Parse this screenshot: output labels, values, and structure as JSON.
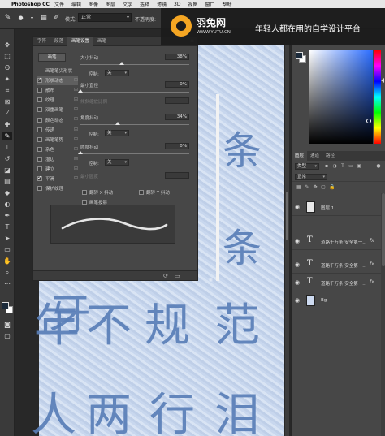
{
  "menubar": {
    "app_name": "Photoshop CC",
    "items": [
      "文件",
      "编辑",
      "图像",
      "图层",
      "文字",
      "选择",
      "滤镜",
      "3D",
      "视图",
      "窗口",
      "帮助"
    ]
  },
  "options_bar": {
    "mode_label": "模式:",
    "mode_value": "正常",
    "opacity_label": "不透明度:"
  },
  "banner": {
    "brand": "羽兔网",
    "url": "WWW.YUTU.CN",
    "slogan": "年轻人都在用的自学设计平台"
  },
  "brush_panel": {
    "tabs": [
      "字符",
      "段落",
      "画笔设置",
      "画笔"
    ],
    "active_tab": "画笔设置",
    "preset_button": "画笔",
    "tip_shape_label": "画笔笔尖形状",
    "options": [
      {
        "label": "形状动态",
        "checked": true,
        "selected": true
      },
      {
        "label": "散布",
        "checked": false
      },
      {
        "label": "纹理",
        "checked": false
      },
      {
        "label": "双重画笔",
        "checked": false
      },
      {
        "label": "颜色动态",
        "checked": false
      },
      {
        "label": "传递",
        "checked": false
      },
      {
        "label": "画笔笔势",
        "checked": false
      },
      {
        "label": "杂色",
        "checked": false
      },
      {
        "label": "湿边",
        "checked": false
      },
      {
        "label": "建立",
        "checked": false
      },
      {
        "label": "平滑",
        "checked": true
      },
      {
        "label": "保护纹理",
        "checked": false
      }
    ],
    "params": {
      "size_jitter_label": "大小抖动",
      "size_jitter_value": "38%",
      "control_label": "控制:",
      "control_value": "关",
      "min_diameter_label": "最小直径",
      "min_diameter_value": "0%",
      "tilt_scale_label": "倾斜缩放比例",
      "angle_jitter_label": "角度抖动",
      "angle_jitter_value": "34%",
      "control2_value": "关",
      "roundness_jitter_label": "圆度抖动",
      "roundness_jitter_value": "0%",
      "control3_value": "关",
      "min_roundness_label": "最小圆度",
      "flip_x": "翻转 X 抖动",
      "flip_y": "翻转 Y 抖动",
      "brush_projection": "画笔投影"
    },
    "levels": {
      "size_jitter": 0.38,
      "min_diameter": 0.0,
      "angle_jitter": 0.34,
      "roundness_jitter": 0.0
    }
  },
  "canvas": {
    "chars": [
      "条",
      "条",
      "年",
      "不",
      "规",
      "范",
      "人",
      "两",
      "行",
      "泪",
      "牙"
    ]
  },
  "layers_panel": {
    "tabs": [
      "图层",
      "通道",
      "路径"
    ],
    "filter_value": "类型",
    "blend_value": "正常",
    "layers": [
      {
        "name": "图层 1",
        "type": "pixel",
        "fx": ""
      },
      {
        "name": "道路千万条 安全第一...",
        "type": "text",
        "fx": "fx"
      },
      {
        "name": "道路千万条 安全第一...",
        "type": "text",
        "fx": "fx"
      },
      {
        "name": "道路千万条 安全第一...",
        "type": "text",
        "fx": "fx"
      },
      {
        "name": "Bg",
        "type": "pixel",
        "fx": ""
      }
    ]
  },
  "colors": {
    "foreground": "#1b2a3a",
    "background": "#ffffff",
    "accent": "#f5a623",
    "ink": "#5a7fb8"
  }
}
